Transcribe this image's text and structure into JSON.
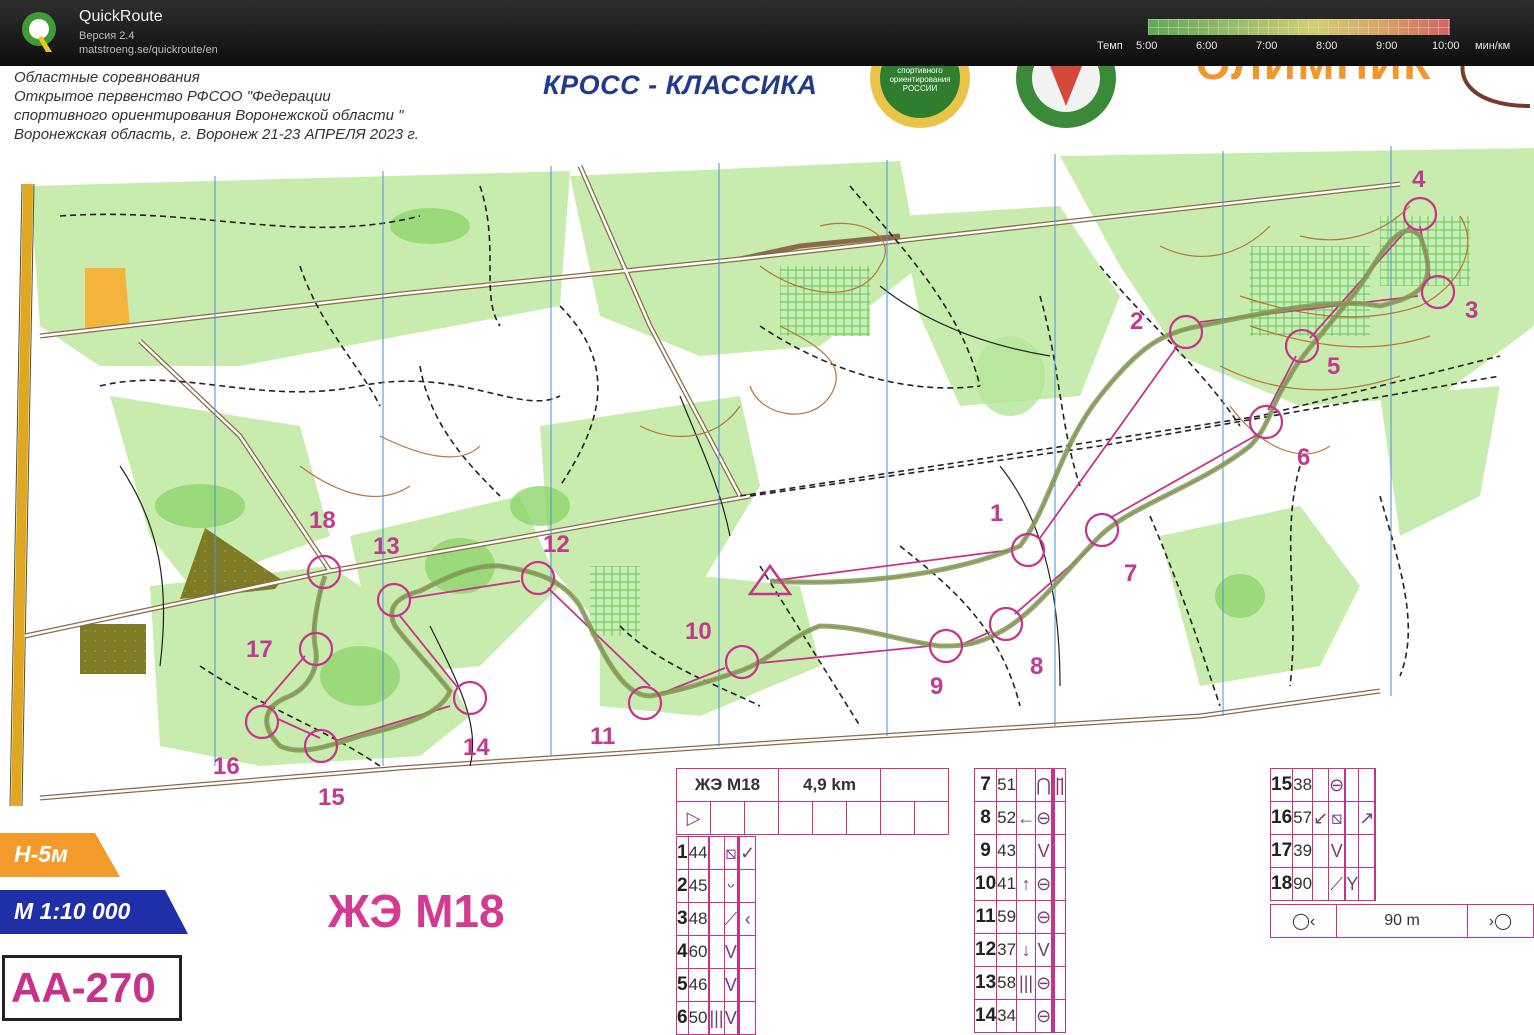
{
  "app": {
    "title": "QuickRoute",
    "version": "Версия 2.4",
    "url": "matstroeng.se/quickroute/en",
    "logo_letter": "Q"
  },
  "pace_scale": {
    "label": "Темп",
    "ticks": [
      "5:00",
      "6:00",
      "7:00",
      "8:00",
      "9:00",
      "10:00"
    ],
    "unit": "мин/км",
    "colors": [
      "#69b85e",
      "#e4e27a",
      "#e46a6a"
    ]
  },
  "map_header": {
    "lines": [
      "Областные соревнования",
      "Открытое первенство РФСОО \"Федерации",
      "спортивного ориентирования Воронежской области \"",
      "Воронежская область, г. Воронеж 21-23 АПРЕЛЯ 2023 г."
    ],
    "discipline": "КРОСС - КЛАССИКА",
    "emblem_text": "спортивного ориентирования РОССИИ",
    "sponsor_partial": "ОЛИМПИК"
  },
  "controls": {
    "labels": [
      "1",
      "2",
      "3",
      "4",
      "5",
      "6",
      "7",
      "8",
      "9",
      "10",
      "11",
      "12",
      "13",
      "14",
      "15",
      "16",
      "17",
      "18"
    ],
    "color": "#c8328b"
  },
  "badges": {
    "contour": "H-5м",
    "scale": "М 1:10 000",
    "code": "АА-270",
    "course": "ЖЭ М18",
    "contour_color": "#f39a2a",
    "scale_color": "#1f2fa8"
  },
  "descriptions": {
    "header": {
      "course": "ЖЭ М18",
      "length": "4,9 km"
    },
    "start_symbol": "▷",
    "table1": [
      {
        "n": "1",
        "code": "44",
        "c": "",
        "d": "",
        "e": "⧅",
        "f": "",
        "g": "",
        "h": "✓"
      },
      {
        "n": "2",
        "code": "45",
        "c": "",
        "d": "",
        "e": "ᵕ",
        "f": "",
        "g": "",
        "h": ""
      },
      {
        "n": "3",
        "code": "48",
        "c": "",
        "d": "",
        "e": "⟋",
        "f": "",
        "g": "",
        "h": "‹"
      },
      {
        "n": "4",
        "code": "60",
        "c": "",
        "d": "",
        "e": "V",
        "f": "",
        "g": "",
        "h": ""
      },
      {
        "n": "5",
        "code": "46",
        "c": "",
        "d": "",
        "e": "V",
        "f": "",
        "g": "",
        "h": ""
      },
      {
        "n": "6",
        "code": "50",
        "c": "",
        "d": "|||",
        "e": "V",
        "f": "",
        "g": "",
        "h": ""
      }
    ],
    "table2": [
      {
        "n": "7",
        "code": "51",
        "c": "",
        "d": "⋂",
        "e": "",
        "f": "",
        "g": "",
        "h": "|̄|"
      },
      {
        "n": "8",
        "code": "52",
        "c": "←",
        "d": "⊖",
        "e": "",
        "f": "",
        "g": "",
        "h": ""
      },
      {
        "n": "9",
        "code": "43",
        "c": "",
        "d": "V",
        "e": "",
        "f": "",
        "g": "",
        "h": ""
      },
      {
        "n": "10",
        "code": "41",
        "c": "↑",
        "d": "⊖",
        "e": "",
        "f": "",
        "g": "",
        "h": ""
      },
      {
        "n": "11",
        "code": "59",
        "c": "",
        "d": "⊖",
        "e": "",
        "f": "",
        "g": "",
        "h": ""
      },
      {
        "n": "12",
        "code": "37",
        "c": "↓",
        "d": "V",
        "e": "",
        "f": "",
        "g": "",
        "h": ""
      },
      {
        "n": "13",
        "code": "58",
        "c": "|||",
        "d": "⊖",
        "e": "",
        "f": "",
        "g": "",
        "h": ""
      },
      {
        "n": "14",
        "code": "34",
        "c": "",
        "d": "⊖",
        "e": "",
        "f": "",
        "g": "",
        "h": ""
      }
    ],
    "table3": [
      {
        "n": "15",
        "code": "38",
        "c": "",
        "d": "⊖",
        "e": "",
        "f": "",
        "g": "",
        "h": ""
      },
      {
        "n": "16",
        "code": "57",
        "c": "↙",
        "d": "⧅",
        "e": "",
        "f": "",
        "g": "↗",
        "h": ""
      },
      {
        "n": "17",
        "code": "39",
        "c": "",
        "d": "V",
        "e": "",
        "f": "",
        "g": "",
        "h": ""
      },
      {
        "n": "18",
        "code": "90",
        "c": "",
        "d": "⟋",
        "e": "",
        "f": "Y",
        "g": "",
        "h": ""
      }
    ],
    "finish": {
      "left": "◯‹",
      "distance": "90 m",
      "right": "›◯"
    }
  }
}
